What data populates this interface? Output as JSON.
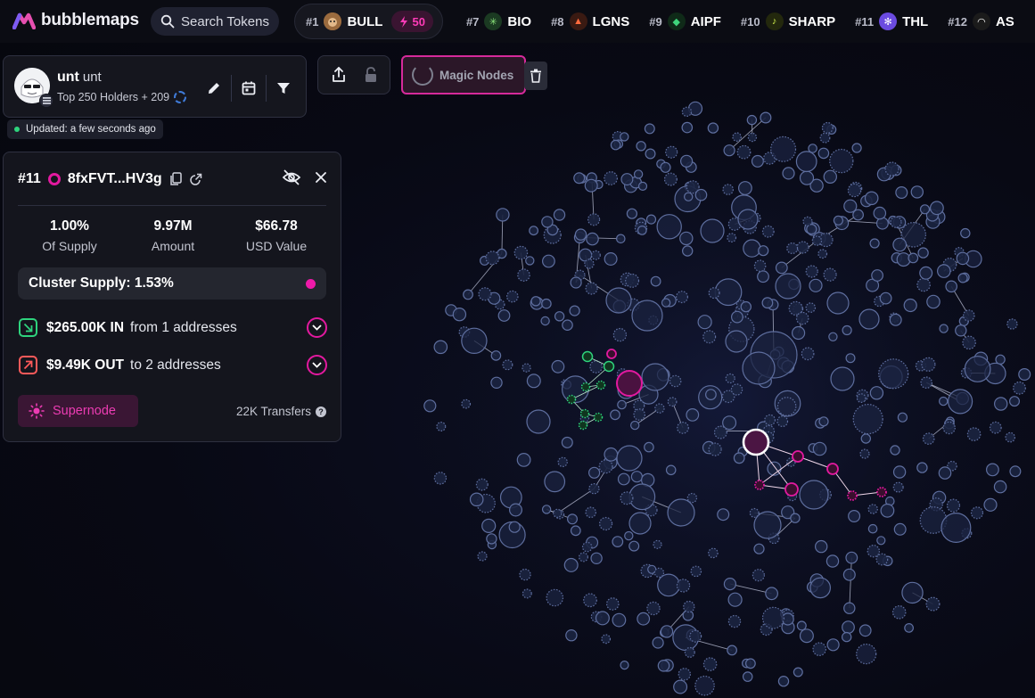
{
  "brand": {
    "name": "bubblemaps"
  },
  "search": {
    "label": "Search Tokens"
  },
  "ticker": {
    "featured": {
      "rank": "#1",
      "name": "BULL",
      "boost": "50"
    },
    "items": [
      {
        "rank": "#7",
        "name": "BIO",
        "color": "#1b3a22",
        "glyph": "✳",
        "glyph_color": "#8be37b"
      },
      {
        "rank": "#8",
        "name": "LGNS",
        "color": "#3a1a12",
        "glyph": "▲",
        "glyph_color": "#ff6a3d"
      },
      {
        "rank": "#9",
        "name": "AIPF",
        "color": "#0f2a18",
        "glyph": "◆",
        "glyph_color": "#3fd57c"
      },
      {
        "rank": "#10",
        "name": "SHARP",
        "color": "#23280d",
        "glyph": "♪",
        "glyph_color": "#c9e84a"
      },
      {
        "rank": "#11",
        "name": "THL",
        "color": "#6b4be0",
        "glyph": "✻",
        "glyph_color": "#ffffff"
      },
      {
        "rank": "#12",
        "name": "AS",
        "color": "#1b1b1b",
        "glyph": "◠",
        "glyph_color": "#ffffff"
      }
    ]
  },
  "token": {
    "name": "unt",
    "symbol": "unt",
    "subtitle": "Top 250 Holders + 209",
    "updated": "Updated: a few seconds ago"
  },
  "magic_nodes": {
    "label": "Magic Nodes"
  },
  "details": {
    "rank": "#11",
    "address": "8fxFVT...HV3g",
    "stats": [
      {
        "value": "1.00%",
        "label": "Of Supply"
      },
      {
        "value": "9.97M",
        "label": "Amount"
      },
      {
        "value": "$66.78",
        "label": "USD Value"
      }
    ],
    "cluster_supply": "Cluster Supply: 1.53%",
    "inflow": {
      "amount": "$265.00K IN",
      "text": "from 1 addresses"
    },
    "outflow": {
      "amount": "$9.49K OUT",
      "text": "to 2 addresses"
    },
    "supernode_label": "Supernode",
    "transfers": "22K Transfers"
  },
  "colors": {
    "accent_pink": "#e2199f",
    "accent_green": "#2ed37d",
    "bubble_fill": "#1b2340",
    "bubble_stroke": "#5e6e9e"
  }
}
